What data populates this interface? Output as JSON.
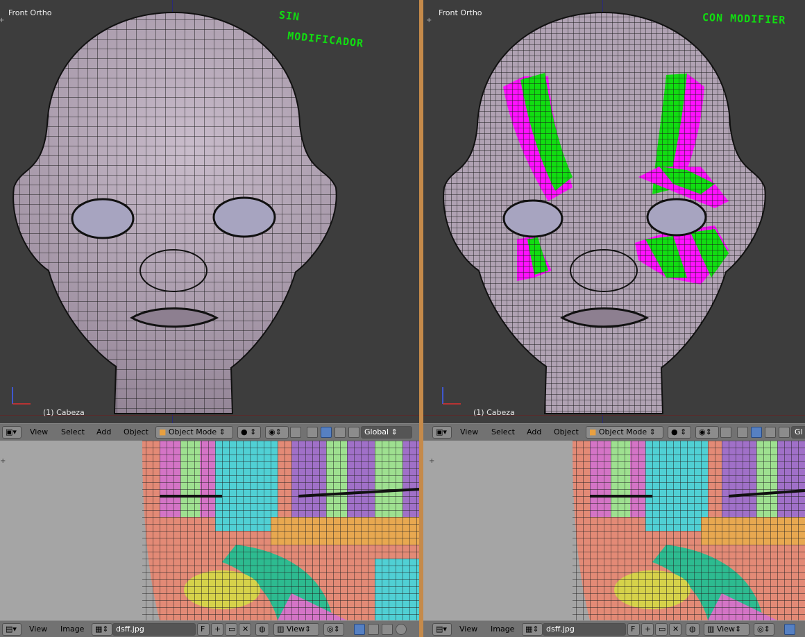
{
  "left": {
    "viewport": {
      "title": "Front Ortho",
      "object_label": "(1) Cabeza",
      "annotation_line1": "SIN",
      "annotation_line2": "MODIFICADOR"
    },
    "header_3d": {
      "menu_view": "View",
      "menu_select": "Select",
      "menu_add": "Add",
      "menu_object": "Object",
      "mode": "Object Mode",
      "orientation": "Global"
    },
    "header_image": {
      "menu_view": "View",
      "menu_image": "Image",
      "filename": "dsff.jpg",
      "fake_user": "F",
      "view_dropdown": "View"
    }
  },
  "right": {
    "viewport": {
      "title": "Front Ortho",
      "object_label": "(1) Cabeza",
      "annotation": "CON MODIFIER"
    },
    "header_3d": {
      "menu_view": "View",
      "menu_select": "Select",
      "menu_add": "Add",
      "menu_object": "Object",
      "mode": "Object Mode",
      "orientation": "Gl"
    },
    "header_image": {
      "menu_view": "View",
      "menu_image": "Image",
      "filename": "dsff.jpg",
      "fake_user": "F",
      "view_dropdown": "View"
    }
  },
  "icons": [
    "3d-view-editor-icon",
    "shading-solid-icon",
    "pivot-icon",
    "snap-icon",
    "manipulator-icon",
    "image-editor-icon",
    "image-browse-icon",
    "new-image-icon",
    "open-image-icon",
    "unlink-icon",
    "pin-icon",
    "uv-sync-icon",
    "render-icon"
  ],
  "colors": {
    "viewport_bg": "#3d3d3d",
    "header_bg": "#727272",
    "image_bg": "#a5a5a5",
    "mesh": "#b4a4b6",
    "wire": "#1c1c1c",
    "uv_green": "#11dd11",
    "uv_magenta": "#ff10ff",
    "divider": "#c58a4a"
  }
}
